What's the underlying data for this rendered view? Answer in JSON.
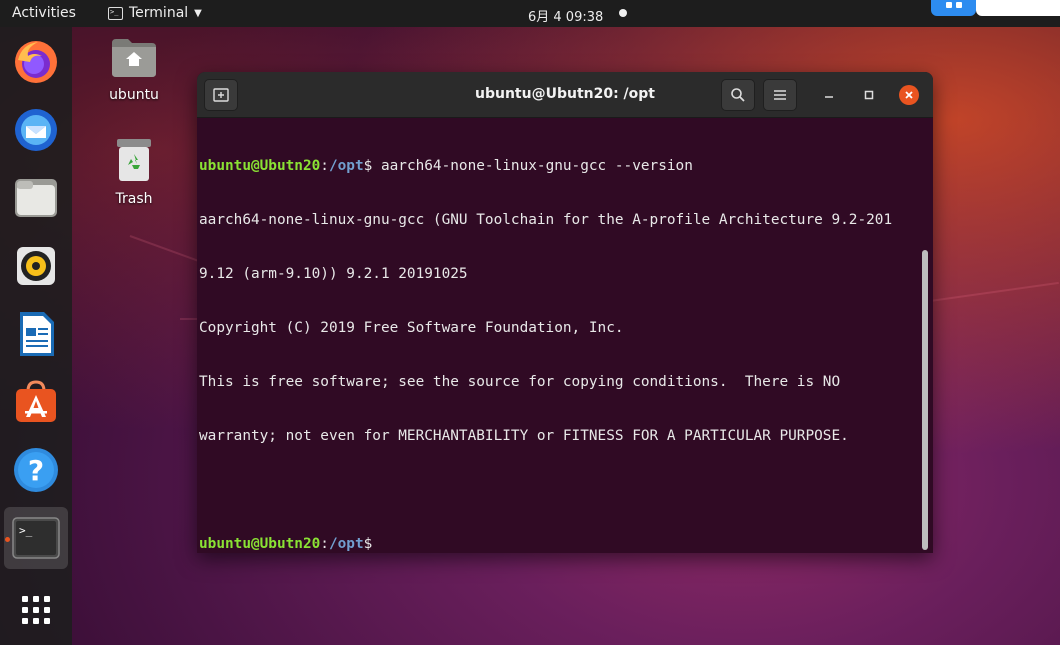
{
  "topbar": {
    "activities": "Activities",
    "app_name": "Terminal",
    "clock": "6月 4  09:38"
  },
  "dock": {
    "items": [
      {
        "name": "firefox",
        "icon": "firefox-icon"
      },
      {
        "name": "thunderbird",
        "icon": "thunderbird-icon"
      },
      {
        "name": "files",
        "icon": "files-icon"
      },
      {
        "name": "rhythmbox",
        "icon": "rhythmbox-icon"
      },
      {
        "name": "libreoffice-writer",
        "icon": "writer-icon"
      },
      {
        "name": "ubuntu-software",
        "icon": "software-icon"
      },
      {
        "name": "help",
        "icon": "help-icon"
      },
      {
        "name": "terminal",
        "icon": "terminal-icon",
        "active": true
      },
      {
        "name": "show-applications",
        "icon": "app-grid-icon"
      }
    ],
    "help_glyph": "?",
    "terminal_glyph": ">_"
  },
  "desktop": {
    "home_label": "ubuntu",
    "trash_label": "Trash"
  },
  "window": {
    "title": "ubuntu@Ubutn20: /opt",
    "prompt_user": "ubuntu@Ubutn20",
    "prompt_sep": ":",
    "prompt_path": "/opt",
    "prompt_symbol": "$ ",
    "command": "aarch64-none-linux-gnu-gcc --version",
    "output": [
      "aarch64-none-linux-gnu-gcc (GNU Toolchain for the A-profile Architecture 9.2-201",
      "9.12 (arm-9.10)) 9.2.1 20191025",
      "Copyright (C) 2019 Free Software Foundation, Inc.",
      "This is free software; see the source for copying conditions.  There is NO",
      "warranty; not even for MERCHANTABILITY or FITNESS FOR A PARTICULAR PURPOSE.",
      ""
    ]
  },
  "colors": {
    "terminal_bg": "#300a24",
    "prompt_user": "#8ae234",
    "prompt_path": "#729fcf",
    "accent": "#e95420"
  }
}
